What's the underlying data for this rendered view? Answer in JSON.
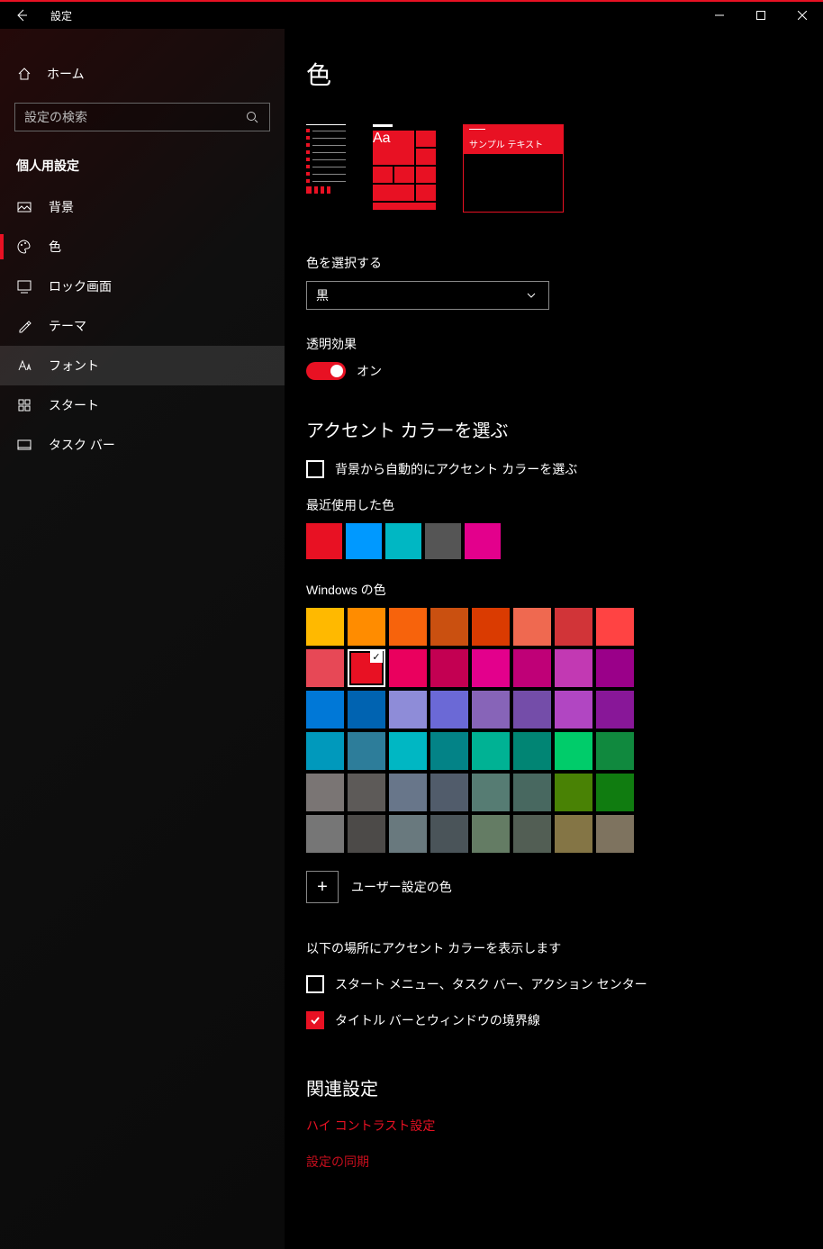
{
  "titlebar": {
    "title": "設定"
  },
  "sidebar": {
    "home": "ホーム",
    "search_placeholder": "設定の検索",
    "section": "個人用設定",
    "items": [
      {
        "label": "背景"
      },
      {
        "label": "色"
      },
      {
        "label": "ロック画面"
      },
      {
        "label": "テーマ"
      },
      {
        "label": "フォント"
      },
      {
        "label": "スタート"
      },
      {
        "label": "タスク バー"
      }
    ]
  },
  "main": {
    "heading": "色",
    "preview_window_text": "サンプル テキスト",
    "preview_aa": "Aa",
    "choose_color_label": "色を選択する",
    "choose_color_value": "黒",
    "transparency_label": "透明効果",
    "transparency_state": "オン",
    "accent_heading": "アクセント カラーを選ぶ",
    "auto_accent_label": "背景から自動的にアクセント カラーを選ぶ",
    "recent_label": "最近使用した色",
    "recent_colors": [
      "#e81123",
      "#0099ff",
      "#00b7c3",
      "#555555",
      "#e3008c"
    ],
    "windows_colors_label": "Windows の色",
    "windows_colors": [
      "#ffb900",
      "#ff8c00",
      "#f7630c",
      "#ca5010",
      "#da3b01",
      "#ef6950",
      "#d13438",
      "#ff4343",
      "#e74856",
      "#e81123",
      "#ea005e",
      "#c30052",
      "#e3008c",
      "#bf0077",
      "#c239b3",
      "#9a0089",
      "#0078d7",
      "#0063b1",
      "#8e8cd8",
      "#6b69d6",
      "#8764b8",
      "#744da9",
      "#b146c2",
      "#881798",
      "#0099bc",
      "#2d7d9a",
      "#00b7c3",
      "#038387",
      "#00b294",
      "#018574",
      "#00cc6a",
      "#10893e",
      "#7a7574",
      "#5d5a58",
      "#68768a",
      "#515c6b",
      "#567c73",
      "#486860",
      "#498205",
      "#107c10",
      "#767676",
      "#4c4a48",
      "#69797e",
      "#4a5459",
      "#647c64",
      "#525e54",
      "#847545",
      "#7e735f"
    ],
    "selected_color_index": 9,
    "custom_color_label": "ユーザー設定の色",
    "surfaces_label": "以下の場所にアクセント カラーを表示します",
    "surface_start_label": "スタート メニュー、タスク バー、アクション センター",
    "surface_title_label": "タイトル バーとウィンドウの境界線",
    "related_heading": "関連設定",
    "link_contrast": "ハイ コントラスト設定",
    "link_sync": "設定の同期"
  }
}
